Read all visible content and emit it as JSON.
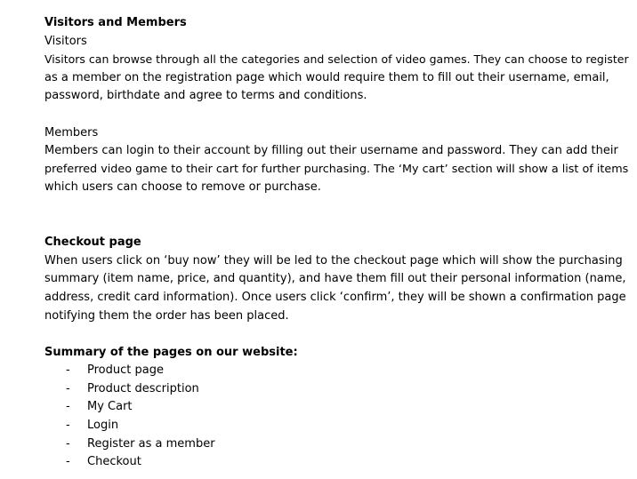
{
  "sections": {
    "visitors_members": {
      "heading": "Visitors and Members",
      "visitors_title": "Visitors",
      "visitors_lines": [
        "Visitors can browse through all the categories and selection of video games. They can choose to register",
        "as a member on the registration page which would require them to fill out their username, email,",
        "password, birthdate and agree to terms and conditions."
      ],
      "members_title": "Members",
      "members_lines": [
        "Members can login to their account by filling out their username and password. They can add their",
        "preferred video game to their cart for further purchasing. The ‘My cart’ section will show a list of items",
        "which users can choose to remove or purchase."
      ]
    },
    "checkout": {
      "heading": "Checkout page",
      "lines": [
        "When users click on ‘buy now’ they will be led to the checkout page which will show the purchasing",
        "summary (item name, price, and quantity), and have them fill out their personal information (name,",
        "address, credit card information). Once users click ‘confirm’, they will be shown a confirmation page",
        "notifying them the order has been placed."
      ]
    },
    "summary": {
      "heading": "Summary of the pages on our website:",
      "bullet": "-",
      "items": [
        "Product page",
        "Product description",
        "My Cart",
        "Login",
        "Register as a member",
        "Checkout"
      ]
    }
  }
}
